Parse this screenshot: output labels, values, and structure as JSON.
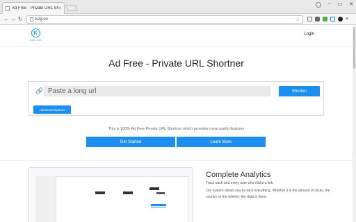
{
  "browser": {
    "tab_title": "Ad Free - Private URL Shor",
    "tab_close": "×",
    "url": "k2g.co",
    "window_controls": [
      "–",
      "▭",
      "✕"
    ]
  },
  "site": {
    "logo_letter": "K",
    "logo_text": "K2G.CO",
    "login_label": "Login"
  },
  "hero": {
    "title": "Ad Free - Private URL Shortner",
    "input_placeholder": "Paste a long url",
    "shorten_label": "Shorten",
    "advanced_label": "Advanced Options",
    "tagline": "This is 100% Ad Free Private URL Shortner which provides more useful features",
    "get_started_label": "Get Started",
    "learn_more_label": "Learn More"
  },
  "feature": {
    "title": "Complete Analytics",
    "subtitle": "Track each and every user who clicks a link.",
    "body": "Our system allows you to track everything. Whether it is the amount of clicks, the country or the referrer, the data is there."
  },
  "colors": {
    "accent": "#1c8ff0",
    "logo": "#1aa0d8"
  }
}
